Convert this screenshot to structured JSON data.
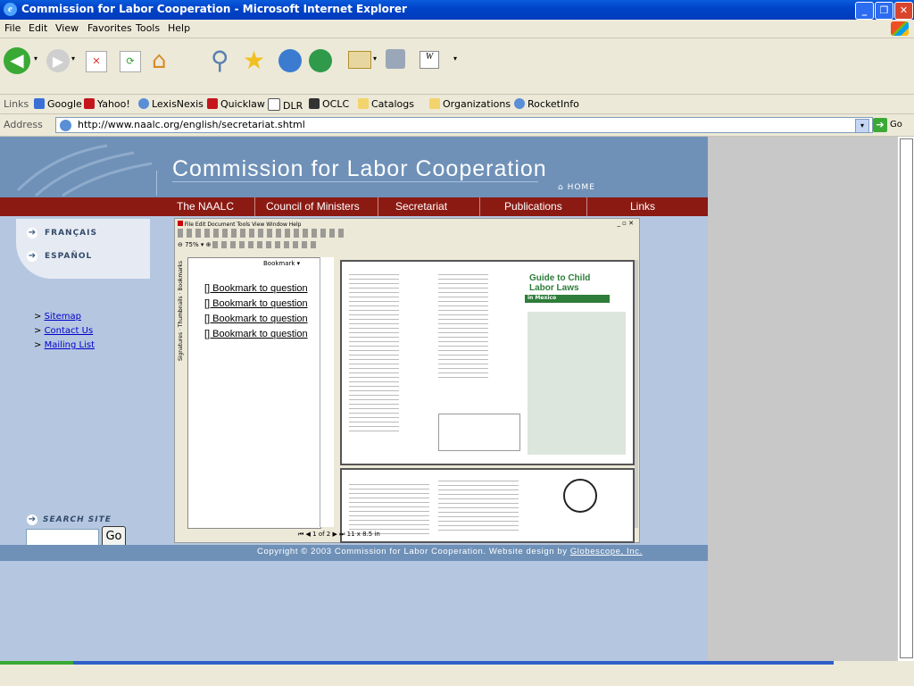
{
  "window": {
    "title": "Commission for Labor Cooperation - Microsoft Internet Explorer"
  },
  "menu": [
    "File",
    "Edit",
    "View",
    "Favorites",
    "Tools",
    "Help"
  ],
  "links": {
    "label": "Links",
    "items": [
      "Google",
      "Yahoo!",
      "LexisNexis",
      "Quicklaw",
      "DLR",
      "OCLC",
      "Catalogs",
      "Organizations",
      "RocketInfo"
    ]
  },
  "address": {
    "label": "Address",
    "url": "http://www.naalc.org/english/secretariat.shtml",
    "go": "Go"
  },
  "site": {
    "title": "Commission for Labor Cooperation",
    "home": "HOME",
    "nav": [
      "The NAALC",
      "Council of Ministers",
      "Secretariat",
      "Publications",
      "Links"
    ],
    "languages": [
      "FRANÇAIS",
      "ESPAÑOL"
    ],
    "sidelinks": [
      "Sitemap",
      "Contact Us",
      "Mailing List"
    ],
    "search_label": "SEARCH SITE",
    "search_go": "Go",
    "copyright": "Copyright © 2003 Commission for Labor Cooperation. Website design by",
    "designer": "Globescope, Inc."
  },
  "pdf": {
    "menu": "File  Edit  Document  Tools  View  Window  Help",
    "zoom": "75%",
    "bookmarks_tab": "Bookmark ▾",
    "bookmarks": [
      "[] Bookmark to question",
      "[] Bookmark to question",
      "[] Bookmark to question",
      "[] Bookmark to question"
    ],
    "tabs": [
      "Bookmarks",
      "Thumbnails",
      "Signatures"
    ],
    "guide_title": "Guide to Child Labor Laws",
    "guide_sub": "in Mexico",
    "pager": "1 of 2",
    "size": "11 x 8.5 in"
  },
  "colors": {
    "titlebar": "#0044c8",
    "nav": "#8b1a13",
    "header": "#6f91b8",
    "page": "#b5c7e0"
  }
}
